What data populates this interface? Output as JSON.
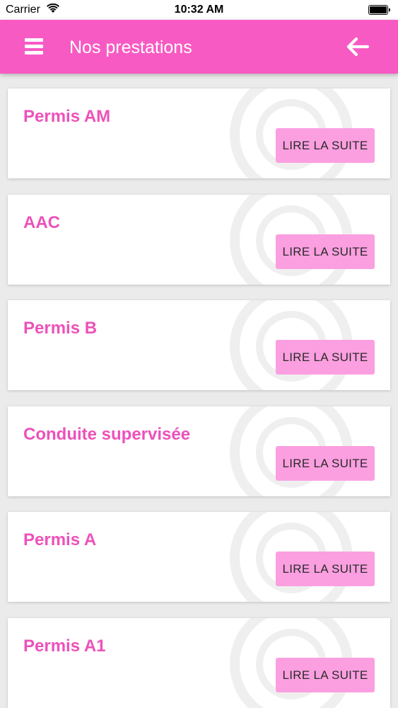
{
  "status_bar": {
    "carrier": "Carrier",
    "time": "10:32 AM",
    "wifi_icon": "wifi-icon",
    "battery_icon": "battery-icon"
  },
  "app_bar": {
    "title": "Nos prestations",
    "menu_icon": "hamburger-menu-icon",
    "back_icon": "arrow-left-icon",
    "color": "#f85ac3"
  },
  "colors": {
    "accent": "#f85ac3",
    "card_title": "#ed51bb",
    "button_bg": "#fb9fe0",
    "background": "#ebebeb"
  },
  "services": [
    {
      "title": "Permis AM",
      "button_label": "LIRE LA SUITE"
    },
    {
      "title": "AAC",
      "button_label": "LIRE LA SUITE"
    },
    {
      "title": "Permis B",
      "button_label": "LIRE LA SUITE"
    },
    {
      "title": "Conduite supervisée",
      "button_label": "LIRE LA SUITE"
    },
    {
      "title": "Permis A",
      "button_label": "LIRE LA SUITE"
    },
    {
      "title": "Permis A1",
      "button_label": "LIRE LA SUITE"
    }
  ]
}
